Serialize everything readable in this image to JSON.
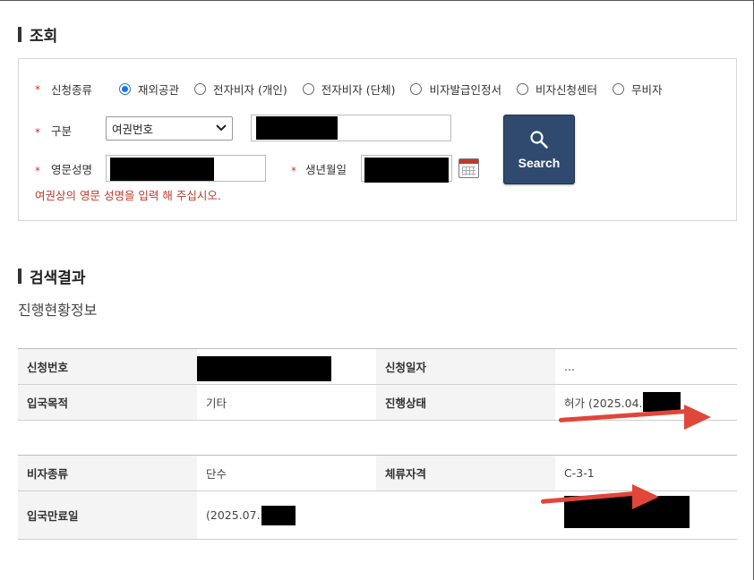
{
  "inquiry": {
    "section_title": "조회",
    "application_type": {
      "label": "신청종류",
      "options": [
        "재외공관",
        "전자비자 (개인)",
        "전자비자 (단체)",
        "비자발급인정서",
        "비자신청센터",
        "무비자"
      ],
      "selected_index": 0
    },
    "category": {
      "label": "구분",
      "selected": "여권번호"
    },
    "english_name": {
      "label": "영문성명",
      "hint": "여권상의 영문 성명을 입력 해 주십시오."
    },
    "birth_date": {
      "label": "생년월일"
    },
    "search_button": "Search",
    "required_mark": "*"
  },
  "results": {
    "section_title": "검색결과",
    "subtitle": "진행현황정보",
    "table1": [
      {
        "h1": "신청번호",
        "v1": "",
        "h2": "신청일자",
        "v2": "..."
      },
      {
        "h1": "입국목적",
        "v1": "기타",
        "h2": "진행상태",
        "v2": "허가 (2025.04."
      }
    ],
    "table2": [
      {
        "h1": "비자종류",
        "v1": "단수",
        "h2": "체류자격",
        "v2": "C-3-1"
      },
      {
        "h1": "입국만료일",
        "v1": "(2025.07.",
        "h2": "",
        "v2": ""
      }
    ]
  },
  "colors": {
    "accent": "#2f4a6e",
    "required": "#d9302b",
    "arrow": "#e0463a",
    "radio_selected": "#1a73e8"
  },
  "icons": [
    "magnifier-icon",
    "calendar-icon",
    "chevron-down-icon",
    "arrow-icon"
  ]
}
